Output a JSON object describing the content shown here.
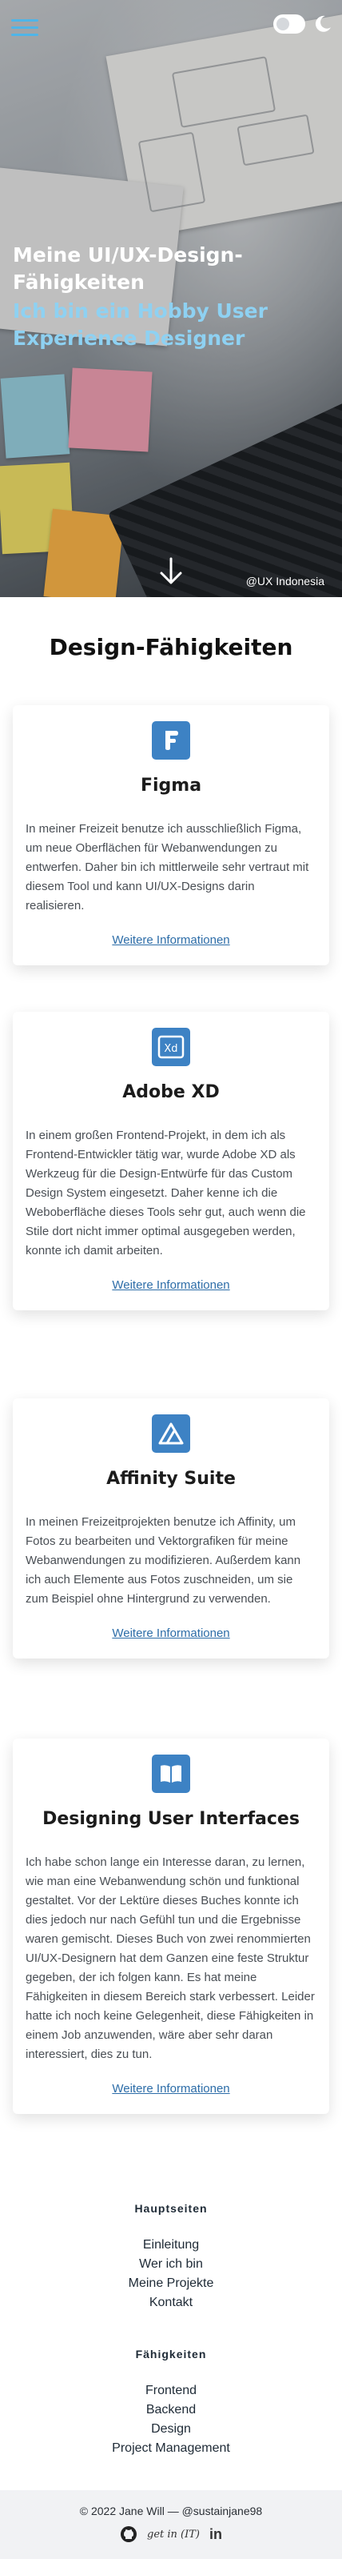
{
  "hero": {
    "title": "Meine UI/UX-Design-Fähigkeiten",
    "subtitle": "Ich bin ein Hobby User Experience Designer",
    "credit": "@UX Indonesia"
  },
  "skills": {
    "title": "Design-Fähigkeiten",
    "cards": [
      {
        "icon": "figma-icon",
        "title": "Figma",
        "text": "In meiner Freizeit benutze ich ausschließlich Figma, um neue Oberflächen für Webanwendungen zu entwerfen. Daher bin ich mittlerweile sehr vertraut mit diesem Tool und kann UI/UX-Designs darin realisieren.",
        "link": "Weitere Informationen"
      },
      {
        "icon": "adobe-xd-icon",
        "title": "Adobe XD",
        "text": "In einem großen Frontend-Projekt, in dem ich als Frontend-Entwickler tätig war, wurde Adobe XD als Werkzeug für die Design-Entwürfe für das Custom Design System eingesetzt. Daher kenne ich die Weboberfläche dieses Tools sehr gut, auch wenn die Stile dort nicht immer optimal ausgegeben werden, konnte ich damit arbeiten.",
        "link": "Weitere Informationen"
      },
      {
        "icon": "affinity-icon",
        "title": "Affinity Suite",
        "text": "In meinen Freizeitprojekten benutze ich Affinity, um Fotos zu bearbeiten und Vektorgrafiken für meine Webanwendungen zu modifizieren. Außerdem kann ich auch Elemente aus Fotos zuschneiden, um sie zum Beispiel ohne Hintergrund zu verwenden.",
        "link": "Weitere Informationen"
      },
      {
        "icon": "book-icon",
        "title": "Designing User Interfaces",
        "text": "Ich habe schon lange ein Interesse daran, zu lernen, wie man eine Webanwendung schön und funktional gestaltet. Vor der Lektüre dieses Buches konnte ich dies jedoch nur nach Gefühl tun und die Ergebnisse waren gemischt. Dieses Buch von zwei renommierten UI/UX-Designern hat dem Ganzen eine feste Struktur gegeben, der ich folgen kann. Es hat meine Fähigkeiten in diesem Bereich stark verbessert. Leider hatte ich noch keine Gelegenheit, diese Fähigkeiten in einem Job anzuwenden, wäre aber sehr daran interessiert, dies zu tun.",
        "link": "Weitere Informationen"
      }
    ]
  },
  "footer": {
    "main_heading": "Hauptseiten",
    "main_links": [
      "Einleitung",
      "Wer ich bin",
      "Meine Projekte",
      "Kontakt"
    ],
    "skills_heading": "Fähigkeiten",
    "skills_links": [
      "Frontend",
      "Backend",
      "Design",
      "Project Management"
    ],
    "copyright": "© 2022 Jane Will — @sustainjane98",
    "getin": "get in (IT)",
    "linkedin": "in"
  },
  "colors": {
    "accent": "#3d82c4",
    "hero_subtitle": "#8ed1f2",
    "link": "#2d6da8",
    "footer_bg": "#f1f2f4"
  }
}
